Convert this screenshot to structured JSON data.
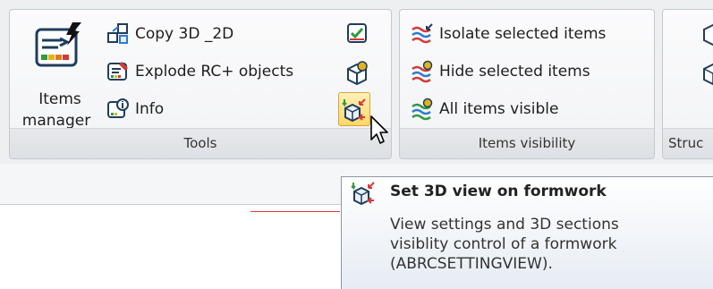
{
  "tools_group": {
    "title": "Tools",
    "items_manager_label_line1": "Items",
    "items_manager_label_line2": "manager",
    "copy_label": "Copy 3D _2D",
    "explode_label": "Explode RC+ objects",
    "info_label": "Info"
  },
  "visibility_group": {
    "title": "Items visibility",
    "isolate_label": "Isolate selected items",
    "hide_label": "Hide selected items",
    "all_visible_label": "All items visible"
  },
  "structure_group": {
    "title_partial": "Struc"
  },
  "tooltip": {
    "title": "Set 3D view on formwork",
    "line1": "View settings and 3D sections",
    "line2": "visiblity control of a formwork",
    "line3": "(ABRCSETTINGVIEW)."
  }
}
